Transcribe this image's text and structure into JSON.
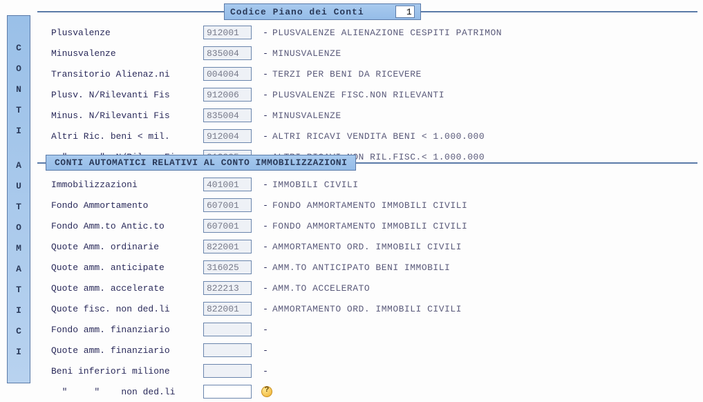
{
  "header": {
    "title": "Codice Piano dei Conti",
    "code": "1"
  },
  "sidebar": {
    "group1": [
      "C",
      "O",
      "N",
      "T",
      "I"
    ],
    "group2": [
      "A",
      "U",
      "T",
      "O",
      "M",
      "A",
      "T",
      "I",
      "C",
      "I"
    ]
  },
  "rowsTop": [
    {
      "label": "Plusvalenze",
      "code": "912001",
      "desc": "PLUSVALENZE ALIENAZIONE CESPITI PATRIMON"
    },
    {
      "label": "Minusvalenze",
      "code": "835004",
      "desc": "MINUSVALENZE"
    },
    {
      "label": "Transitorio Alienaz.ni",
      "code": "004004",
      "desc": "TERZI PER BENI DA RICEVERE"
    },
    {
      "label": "Plusv. N/Rilevanti Fis",
      "code": "912006",
      "desc": "PLUSVALENZE FISC.NON RILEVANTI"
    },
    {
      "label": "Minus. N/Rilevanti Fis",
      "code": "835004",
      "desc": "MINUSVALENZE"
    },
    {
      "label": "Altri Ric. beni < mil.",
      "code": "912004",
      "desc": "ALTRI RICAVI VENDITA BENI < 1.000.000"
    },
    {
      "label": "  \"      \"  N/Rilev. Fis",
      "code": "912005",
      "desc": "ALTRI RICAVI NON RIL.FISC.< 1.000.000"
    }
  ],
  "sectionTitle": "CONTI AUTOMATICI RELATIVI AL CONTO IMMOBILIZZAZIONI",
  "rowsBottom": [
    {
      "label": "Immobilizzazioni",
      "code": "401001",
      "desc": "IMMOBILI CIVILI"
    },
    {
      "label": "Fondo Ammortamento",
      "code": "607001",
      "desc": "FONDO AMMORTAMENTO IMMOBILI CIVILI"
    },
    {
      "label": "Fondo Amm.to Antic.to",
      "code": "607001",
      "desc": "FONDO AMMORTAMENTO IMMOBILI CIVILI"
    },
    {
      "label": "Quote Amm. ordinarie",
      "code": "822001",
      "desc": "AMMORTAMENTO ORD. IMMOBILI CIVILI"
    },
    {
      "label": "Quote amm. anticipate",
      "code": "316025",
      "desc": "AMM.TO ANTICIPATO BENI IMMOBILI"
    },
    {
      "label": "Quote amm. accelerate",
      "code": "822213",
      "desc": "AMM.TO ACCELERATO"
    },
    {
      "label": "Quote fisc. non ded.li",
      "code": "822001",
      "desc": "AMMORTAMENTO ORD. IMMOBILI CIVILI"
    },
    {
      "label": "Fondo amm. finanziario",
      "code": "",
      "desc": ""
    },
    {
      "label": "Quote amm. finanziario",
      "code": "",
      "desc": ""
    },
    {
      "label": "Beni inferiori milione",
      "code": "",
      "desc": ""
    },
    {
      "label": "  \"     \"    non ded.li",
      "code": "",
      "desc": "",
      "active": true,
      "help": true
    }
  ]
}
